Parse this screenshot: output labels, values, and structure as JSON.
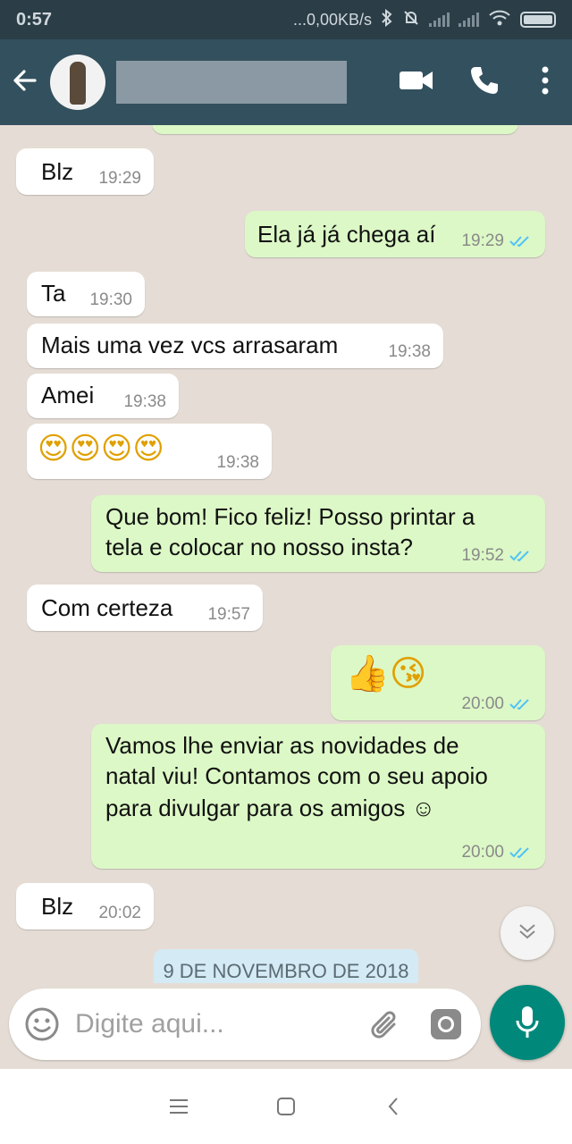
{
  "status_bar": {
    "time": "0:57",
    "network_speed": "...0,00KB/s"
  },
  "header": {
    "contact_name_redacted": ""
  },
  "messages": [
    {
      "dir": "in",
      "text": "Blz",
      "time": "19:29"
    },
    {
      "dir": "out",
      "text": "Ela já já chega aí",
      "time": "19:29"
    },
    {
      "dir": "in",
      "text": "Ta",
      "time": "19:30"
    },
    {
      "dir": "in",
      "text": "Mais uma vez vcs arrasaram",
      "time": "19:38"
    },
    {
      "dir": "in",
      "text": "Amei",
      "time": "19:38"
    },
    {
      "dir": "in",
      "text": "😍😍😍😍",
      "time": "19:38"
    },
    {
      "dir": "out",
      "text_line1": "Que bom! Fico feliz! Posso printar a",
      "text_line2": "tela e colocar no nosso insta?",
      "time": "19:52"
    },
    {
      "dir": "in",
      "text": "Com certeza",
      "time": "19:57"
    },
    {
      "dir": "out",
      "text": "👍😘",
      "time": "20:00"
    },
    {
      "dir": "out",
      "text_line1": "Vamos lhe enviar as novidades de",
      "text_line2": "natal viu! Contamos com o seu apoio",
      "text_line3": "para divulgar para os amigos ☺",
      "time": "20:00"
    },
    {
      "dir": "in",
      "text": "Blz",
      "time": "20:02"
    }
  ],
  "date_chip": "9 DE NOVEMBRO DE 2018",
  "composer": {
    "placeholder": "Digite aqui..."
  },
  "colors": {
    "status_bar": "#2b3d47",
    "app_bar": "#33505e",
    "chat_bg": "#e5ddd5",
    "incoming": "#ffffff",
    "outgoing": "#dcf8c6",
    "read_ticks": "#4fc3f7",
    "mic_button": "#00897b"
  },
  "icons": [
    "back-arrow-icon",
    "video-call-icon",
    "phone-icon",
    "more-vert-icon",
    "emoji-icon",
    "attach-icon",
    "camera-icon",
    "mic-icon",
    "scroll-down-icon"
  ]
}
